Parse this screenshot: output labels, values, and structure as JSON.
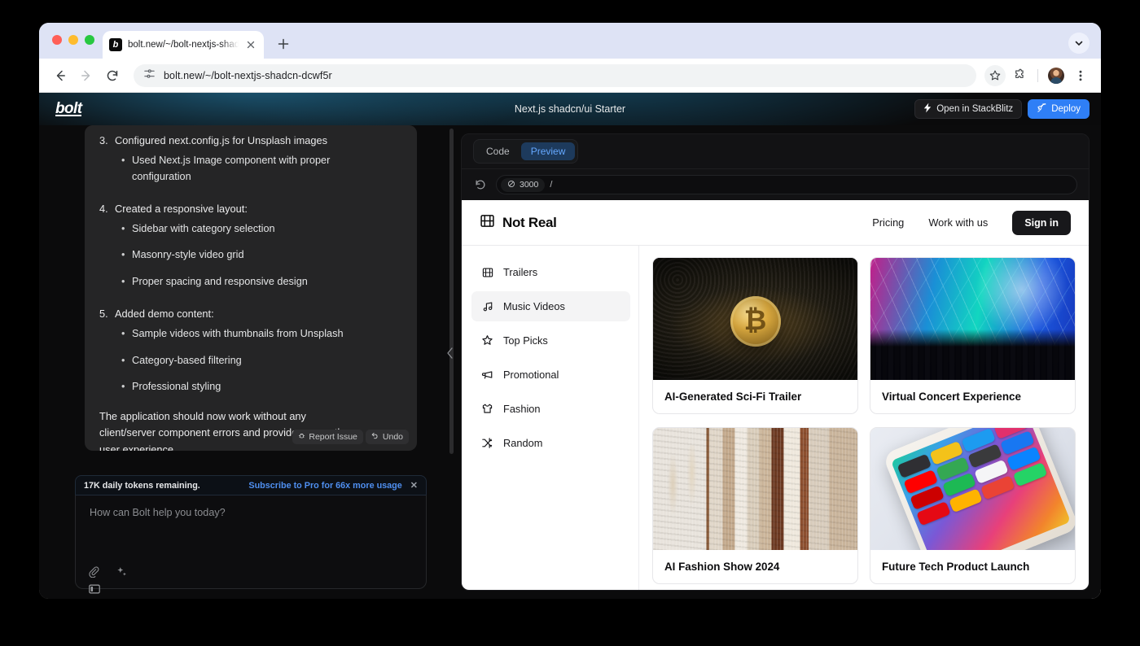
{
  "browser": {
    "tab": {
      "title": "bolt.new/~/bolt-nextjs-shadc",
      "favicon": "b",
      "close_icon": "close-icon"
    },
    "new_tab_label": "+",
    "omnibox": {
      "url": "bolt.new/~/bolt-nextjs-shadcn-dcwf5r",
      "site_info_icon": "site-settings-icon"
    },
    "icons": {
      "back": "back-arrow-icon",
      "forward": "forward-arrow-icon",
      "reload": "reload-icon",
      "bookmark": "star-icon",
      "extensions": "puzzle-icon",
      "profile": "avatar",
      "menu": "three-dot-menu-icon",
      "tab_list": "chevron-down-icon"
    }
  },
  "bolt": {
    "logo": "bolt",
    "project_title": "Next.js shadcn/ui Starter",
    "stackblitz_button": "Open in StackBlitz",
    "deploy_button": "Deploy",
    "message": {
      "steps": [
        {
          "n": 3,
          "heading": "Configured next.config.js for Unsplash images",
          "items": [
            "Used Next.js Image component with proper configuration"
          ]
        },
        {
          "n": 4,
          "heading": "Created a responsive layout:",
          "items": [
            "Sidebar with category selection",
            "Masonry-style video grid",
            "Proper spacing and responsive design"
          ]
        },
        {
          "n": 5,
          "heading": "Added demo content:",
          "items": [
            "Sample videos with thumbnails from Unsplash",
            "Category-based filtering",
            "Professional styling"
          ]
        }
      ],
      "closing": "The application should now work without any client/server component errors and provide a smooth user experience.",
      "report_issue": "Report Issue",
      "undo": "Undo"
    },
    "token_bar": {
      "text": "17K daily tokens remaining.",
      "link": "Subscribe to Pro for 66x more usage",
      "close": "✕"
    },
    "prompt": {
      "placeholder": "How can Bolt help you today?",
      "attach_icon": "paperclip-icon",
      "enhance_icon": "sparkles-icon"
    },
    "panel_toggle_icon": "sidebar-toggle-icon",
    "collapse_icon": "chevron-left-icon"
  },
  "preview": {
    "tabs": [
      {
        "label": "Code",
        "active": false
      },
      {
        "label": "Preview",
        "active": true
      }
    ],
    "reload_icon": "reload-icon",
    "port": "3000",
    "path": "/",
    "accent_color": "#65a8ff"
  },
  "site": {
    "brand": {
      "name": "Not Real",
      "icon": "film-strip-icon"
    },
    "nav": [
      {
        "label": "Pricing"
      },
      {
        "label": "Work with us"
      }
    ],
    "signin_label": "Sign in",
    "sidebar": [
      {
        "label": "Trailers",
        "icon": "film-strip-icon",
        "active": false
      },
      {
        "label": "Music Videos",
        "icon": "music-note-icon",
        "active": true
      },
      {
        "label": "Top Picks",
        "icon": "star-icon",
        "active": false
      },
      {
        "label": "Promotional",
        "icon": "megaphone-icon",
        "active": false
      },
      {
        "label": "Fashion",
        "icon": "shirt-icon",
        "active": false
      },
      {
        "label": "Random",
        "icon": "shuffle-icon",
        "active": false
      }
    ],
    "cards": [
      {
        "title": "AI-Generated Sci-Fi Trailer",
        "art": "art-bitcoin"
      },
      {
        "title": "Virtual Concert Experience",
        "art": "art-concert"
      },
      {
        "title": "AI Fashion Show 2024",
        "art": "art-fashion"
      },
      {
        "title": "Future Tech Product Launch",
        "art": "art-phone"
      }
    ]
  }
}
